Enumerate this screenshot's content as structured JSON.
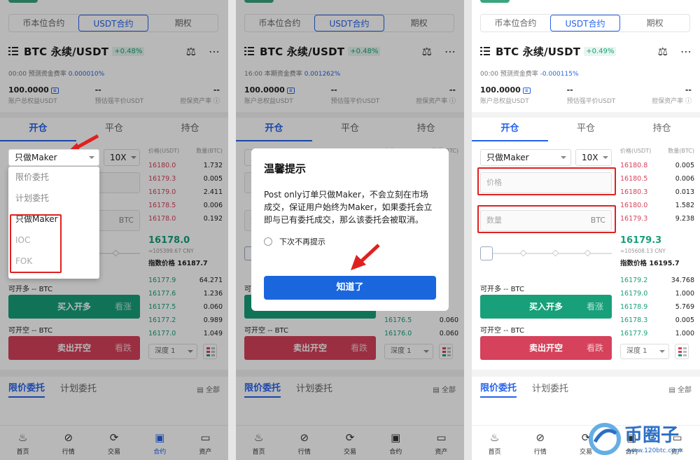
{
  "contract_tabs": [
    "币本位合约",
    "USDT合约",
    "期权"
  ],
  "order_tabs": [
    "开仓",
    "平仓",
    "持仓"
  ],
  "order_type": "只做Maker",
  "leverage": "10X",
  "ob_header": {
    "price": "价格(USDT)",
    "qty": "数量(BTC)"
  },
  "labels": {
    "acct_equity": "账户总权益USDT",
    "est_liq": "预估强平价USDT",
    "margin_ratio": "担保资产率",
    "can_long": "可开多 -- BTC",
    "can_short": "可开空 -- BTC",
    "buy": "买入开多",
    "buy_sub": "看涨",
    "sell": "卖出开空",
    "sell_sub": "看跌",
    "index_prefix": "指数价格",
    "depth": "深度 1",
    "limit_orders": "限价委托",
    "plan_orders": "计划委托",
    "all": "全部",
    "price_ph": "价格",
    "qty_ph": "数量",
    "btc": "BTC",
    "dash": "--"
  },
  "nav": [
    "首页",
    "行情",
    "交易",
    "合约",
    "资产"
  ],
  "dropdown": [
    "限价委托",
    "计划委托",
    "只做Maker",
    "IOC",
    "FOK"
  ],
  "dialog": {
    "title": "温馨提示",
    "body": "Post only订单只做Maker，不会立刻在市场成交，保证用户始终为Maker，如果委托会立即与已有委托成交，那么该委托会被取消。",
    "check": "下次不再提示",
    "ok": "知道了"
  },
  "panels": [
    {
      "title": "BTC 永续/USDT",
      "change": "+0.48%",
      "fund_label": "00:00 预测资金费率",
      "fund_rate": "0.000010%",
      "equity": "100.0000",
      "asks": [
        [
          "16180.0",
          "1.732"
        ],
        [
          "16179.3",
          "0.005"
        ],
        [
          "16179.0",
          "2.411"
        ],
        [
          "16178.5",
          "0.006"
        ],
        [
          "16178.0",
          "0.192"
        ]
      ],
      "last": "16178.0",
      "cny": "≈105399.67 CNY",
      "index": "16187.7",
      "bids": [
        [
          "16177.9",
          "64.271"
        ],
        [
          "16177.6",
          "1.236"
        ],
        [
          "16177.5",
          "0.060"
        ],
        [
          "16177.2",
          "0.989"
        ],
        [
          "16177.0",
          "1.049"
        ]
      ]
    },
    {
      "title": "BTC 永续/USDT",
      "change": "+0.48%",
      "fund_label": "16:00 本期资金费率",
      "fund_rate": "0.001262%",
      "equity": "100.0000",
      "bids": [
        [
          "16176.5",
          "0.060"
        ],
        [
          "16176.0",
          "0.060"
        ]
      ]
    },
    {
      "title": "BTC 永续/USDT",
      "change": "+0.49%",
      "fund_label": "00:00 预测资金费率",
      "fund_rate": "-0.000115%",
      "equity": "100.0000",
      "asks": [
        [
          "16180.8",
          "0.005"
        ],
        [
          "16180.5",
          "0.006"
        ],
        [
          "16180.3",
          "0.013"
        ],
        [
          "16180.0",
          "1.582"
        ],
        [
          "16179.3",
          "9.238"
        ]
      ],
      "last": "16179.3",
      "cny": "≈105608.13 CNY",
      "index": "16195.7",
      "bids": [
        [
          "16179.2",
          "34.768"
        ],
        [
          "16179.0",
          "1.000"
        ],
        [
          "16178.9",
          "5.769"
        ],
        [
          "16178.3",
          "0.005"
        ],
        [
          "16177.9",
          "1.000"
        ]
      ]
    }
  ],
  "watermark": {
    "brand": "币圈子",
    "url": "www.120btc.com"
  },
  "colors": {
    "accent": "#2563eb",
    "buy": "#17a07a",
    "sell": "#d6425b",
    "highlight": "#e02020"
  }
}
